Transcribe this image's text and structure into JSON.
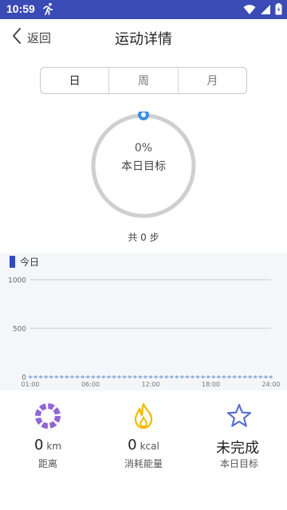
{
  "status": {
    "time": "10:59"
  },
  "header": {
    "back_label": "返回",
    "title": "运动详情"
  },
  "tabs": [
    {
      "label": "日"
    },
    {
      "label": "周"
    },
    {
      "label": "月"
    }
  ],
  "progress": {
    "percent_text": "0%",
    "label": "本日目标",
    "value": 0
  },
  "total_steps": "共 0 步",
  "chart_data": {
    "type": "line",
    "legend": "今日",
    "x_ticks": [
      "01:00",
      "06:00",
      "12:00",
      "18:00",
      "24:00"
    ],
    "y_ticks": [
      1000,
      500,
      0
    ],
    "ylim": [
      0,
      1000
    ],
    "series": [
      {
        "name": "今日",
        "values": [
          0,
          0,
          0,
          0,
          0,
          0,
          0,
          0,
          0,
          0,
          0,
          0,
          0,
          0,
          0,
          0,
          0,
          0,
          0,
          0,
          0,
          0,
          0,
          0,
          0,
          0,
          0,
          0,
          0,
          0,
          0,
          0,
          0,
          0,
          0,
          0,
          0,
          0,
          0,
          0,
          0,
          0,
          0,
          0,
          0,
          0,
          0
        ]
      }
    ],
    "grid": true
  },
  "stats": [
    {
      "value": "0",
      "unit": "km",
      "label": "距离",
      "icon": "distance-ring-icon"
    },
    {
      "value": "0",
      "unit": "kcal",
      "label": "消耗能量",
      "icon": "flame-icon"
    },
    {
      "value": "未完成",
      "unit": "",
      "label": "本日目标",
      "icon": "star-icon"
    }
  ],
  "colors": {
    "statusbar": "#3b4bb5",
    "accent": "#2f4bc3",
    "ring": "#cfcfcf",
    "ring_dot": "#3a8ee6",
    "chart_dot": "#8fb0e0",
    "purple": "#9266d6",
    "amber": "#f3b700",
    "star": "#5a6fd0"
  }
}
